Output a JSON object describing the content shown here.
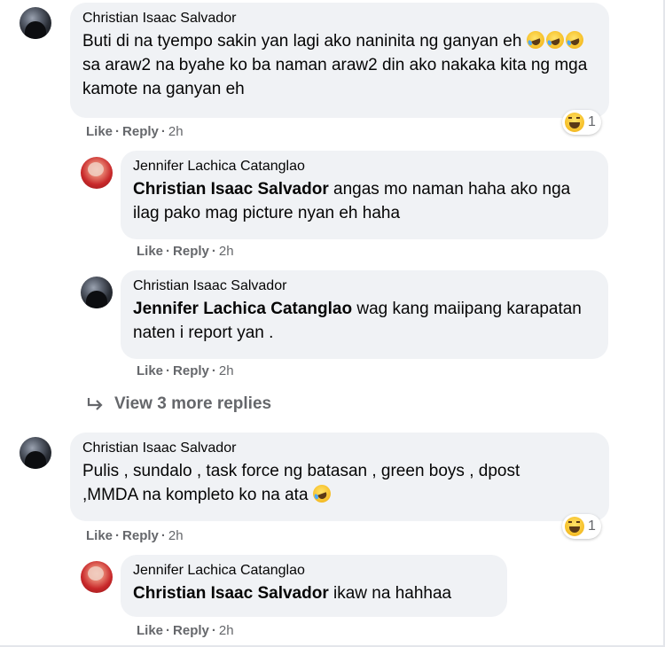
{
  "comments": [
    {
      "author": "Christian Isaac Salvador",
      "text_before": "Buti di na tyempo sakin yan lagi ako naninita ng ganyan eh ",
      "text_after": " sa araw2 na byahe ko ba naman araw2 din ako nakaka kita ng mga kamote na ganyan eh",
      "inline_emoji": "rolling-on-floor-laughing-emoji x3",
      "reaction": "haha",
      "reaction_count": "1",
      "actions": {
        "like": "Like",
        "reply": "Reply",
        "time": "2h"
      }
    },
    {
      "author": "Jennifer Lachica Catanglao",
      "mention": "Christian Isaac Salvador",
      "text": " angas mo naman haha ako nga ilag pako mag picture nyan eh haha",
      "actions": {
        "like": "Like",
        "reply": "Reply",
        "time": "2h"
      }
    },
    {
      "author": "Christian Isaac Salvador",
      "mention": "Jennifer Lachica Catanglao",
      "text": " wag kang maiipang karapatan naten i report yan .",
      "actions": {
        "like": "Like",
        "reply": "Reply",
        "time": "2h"
      }
    },
    {
      "author": "Christian Isaac Salvador",
      "text": "Pulis , sundalo , task force ng batasan , green boys , dpost ,MMDA na kompleto ko na ata ",
      "inline_emoji": "rolling-on-floor-laughing-emoji",
      "reaction": "haha",
      "reaction_count": "1",
      "actions": {
        "like": "Like",
        "reply": "Reply",
        "time": "2h"
      }
    },
    {
      "author": "Jennifer Lachica Catanglao",
      "mention": "Christian Isaac Salvador",
      "text": " ikaw na hahhaa",
      "actions": {
        "like": "Like",
        "reply": "Reply",
        "time": "2h"
      }
    }
  ],
  "view_more": "View 3 more replies",
  "colors": {
    "bubble": "#f0f2f5",
    "meta": "#65676b",
    "text": "#050505"
  }
}
